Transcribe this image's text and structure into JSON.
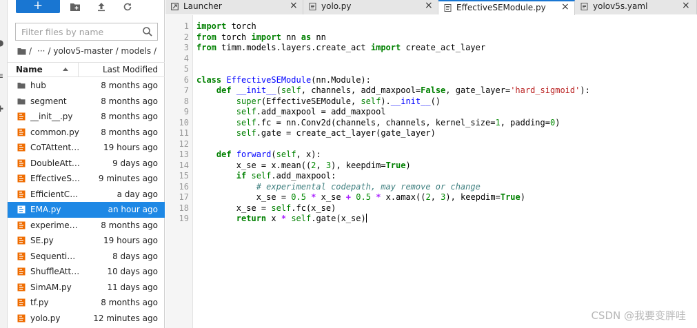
{
  "toolbar": {
    "new_label": "+",
    "icons": [
      "new-folder-icon",
      "upload-icon",
      "refresh-icon"
    ]
  },
  "search": {
    "placeholder": "Filter files by name",
    "value": ""
  },
  "breadcrumb": {
    "root": "/",
    "ellipsis": "···",
    "path": "/ yolov5-master / models /"
  },
  "columns": {
    "name": "Name",
    "modified": "Last Modified"
  },
  "files": [
    {
      "name": "hub",
      "modified": "8 months ago",
      "type": "folder"
    },
    {
      "name": "segment",
      "modified": "8 months ago",
      "type": "folder"
    },
    {
      "name": "__init__.py",
      "modified": "8 months ago",
      "type": "python"
    },
    {
      "name": "common.py",
      "modified": "8 months ago",
      "type": "python"
    },
    {
      "name": "CoTAttenti…",
      "modified": "19 hours ago",
      "type": "python"
    },
    {
      "name": "DoubleAtt…",
      "modified": "9 days ago",
      "type": "python"
    },
    {
      "name": "EffectiveS…",
      "modified": "9 minutes ago",
      "type": "python"
    },
    {
      "name": "EfficientCh…",
      "modified": "a day ago",
      "type": "python"
    },
    {
      "name": "EMA.py",
      "modified": "an hour ago",
      "type": "python",
      "selected": true
    },
    {
      "name": "experimen…",
      "modified": "8 months ago",
      "type": "python"
    },
    {
      "name": "SE.py",
      "modified": "19 hours ago",
      "type": "python"
    },
    {
      "name": "Sequential…",
      "modified": "8 days ago",
      "type": "python"
    },
    {
      "name": "ShuffleAtte…",
      "modified": "10 days ago",
      "type": "python"
    },
    {
      "name": "SimAM.py",
      "modified": "11 days ago",
      "type": "python"
    },
    {
      "name": "tf.py",
      "modified": "8 months ago",
      "type": "python"
    },
    {
      "name": "yolo.py",
      "modified": "12 minutes ago",
      "type": "python"
    }
  ],
  "tabs": [
    {
      "label": "Launcher",
      "icon": "launcher-icon",
      "active": false
    },
    {
      "label": "yolo.py",
      "icon": "python-file-icon",
      "active": false
    },
    {
      "label": "EffectiveSEModule.py",
      "icon": "python-file-icon",
      "active": true
    },
    {
      "label": "yolov5s.yaml",
      "icon": "yaml-file-icon",
      "active": false
    }
  ],
  "code": {
    "line_numbers": [
      "1",
      "2",
      "3",
      "4",
      "5",
      "6",
      "7",
      "8",
      "9",
      "10",
      "11",
      "12",
      "13",
      "14",
      "15",
      "16",
      "17",
      "18",
      "19"
    ]
  },
  "watermark": "CSDN @我要变胖哇",
  "colors": {
    "accent": "#1976d2",
    "selected_row": "#1e88e5",
    "python_icon": "#ef6c00",
    "folder_icon": "#616161"
  }
}
